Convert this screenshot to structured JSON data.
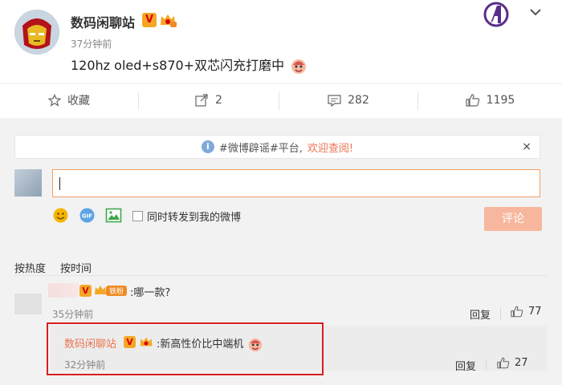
{
  "post": {
    "author": "数码闲聊站",
    "verified_badge": "V",
    "time": "37分钟前",
    "content": "120hz oled+s870+双芯闪充打磨中",
    "colors": {
      "author": "#333333",
      "link": "#eb7350",
      "badge": "#f5a623"
    }
  },
  "actions": {
    "favorite_label": "收藏",
    "repost_count": "2",
    "comment_count": "282",
    "like_count": "1195"
  },
  "notice": {
    "text": "#微博辟谣#平台,",
    "link": "欢迎查阅!",
    "close": "×"
  },
  "composer": {
    "input_value": "",
    "forward_label": "同时转发到我的微博",
    "submit_label": "评论"
  },
  "sort": {
    "hot": "按热度",
    "time": "按时间"
  },
  "comments": [
    {
      "badge": "V",
      "fans_label": "铁粉",
      "text": ":哪一款?",
      "time": "35分钟前",
      "reply_label": "回复",
      "likes": "77"
    },
    {
      "name": "数码闲聊站",
      "badge": "V",
      "text": ":新高性价比中端机",
      "time": "32分钟前",
      "reply_label": "回复",
      "likes": "27"
    }
  ]
}
